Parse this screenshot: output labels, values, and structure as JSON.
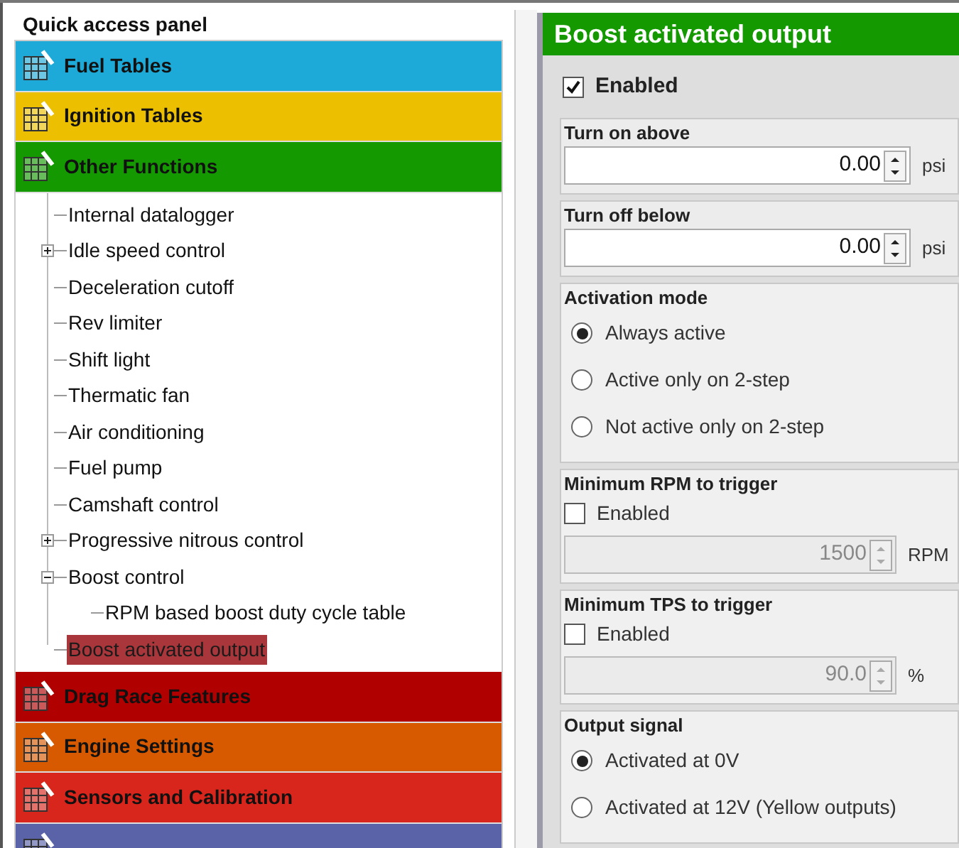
{
  "left_panel": {
    "title": "Quick access panel",
    "categories": [
      {
        "label": "Fuel Tables",
        "color": "#1eaad8"
      },
      {
        "label": "Ignition Tables",
        "color": "#ecc000"
      },
      {
        "label": "Other Functions",
        "color": "#149a00",
        "tree": [
          {
            "label": "Internal datalogger",
            "selected": false
          },
          {
            "label": "Idle speed control",
            "selected": false,
            "expanded": false
          },
          {
            "label": "Deceleration cutoff",
            "selected": false
          },
          {
            "label": "Rev limiter",
            "selected": false
          },
          {
            "label": "Shift light",
            "selected": false
          },
          {
            "label": "Thermatic fan",
            "selected": false
          },
          {
            "label": "Air conditioning",
            "selected": false
          },
          {
            "label": "Fuel pump",
            "selected": false
          },
          {
            "label": "Camshaft control",
            "selected": false
          },
          {
            "label": "Progressive nitrous control",
            "selected": false,
            "expanded": false
          },
          {
            "label": "Boost control",
            "selected": false,
            "expanded": true,
            "children": [
              {
                "label": "RPM based boost duty cycle table",
                "selected": false
              }
            ]
          },
          {
            "label": "Boost activated output",
            "selected": true
          }
        ]
      },
      {
        "label": "Drag Race Features",
        "color": "#b00000"
      },
      {
        "label": "Engine Settings",
        "color": "#d85a00"
      },
      {
        "label": "Sensors and Calibration",
        "color": "#d8261c"
      },
      {
        "color": "#5a63a8"
      }
    ]
  },
  "right_panel": {
    "title": "Boost activated output",
    "enabled": {
      "label": "Enabled",
      "checked": true
    },
    "sections": [
      {
        "kind": "number",
        "title": "Turn on above",
        "value": "0.00",
        "unit": "psi"
      },
      {
        "kind": "number",
        "title": "Turn off below",
        "value": "0.00",
        "unit": "psi"
      },
      {
        "kind": "radio",
        "title": "Activation mode",
        "options": [
          {
            "label": "Always active",
            "selected": true
          },
          {
            "label": "Active only on 2-step",
            "selected": false
          },
          {
            "label": "Not active only on 2-step",
            "selected": false
          }
        ]
      },
      {
        "kind": "toggle_number",
        "title": "Minimum RPM to trigger",
        "check_label": "Enabled",
        "checked": false,
        "value": "1500",
        "unit": "RPM"
      },
      {
        "kind": "toggle_number",
        "title": "Minimum TPS to trigger",
        "check_label": "Enabled",
        "checked": false,
        "value": "90.0",
        "unit": "%"
      },
      {
        "kind": "radio",
        "title": "Output signal",
        "options": [
          {
            "label": "Activated at 0V",
            "selected": true
          },
          {
            "label": "Activated at 12V (Yellow outputs)",
            "selected": false
          }
        ]
      }
    ]
  }
}
